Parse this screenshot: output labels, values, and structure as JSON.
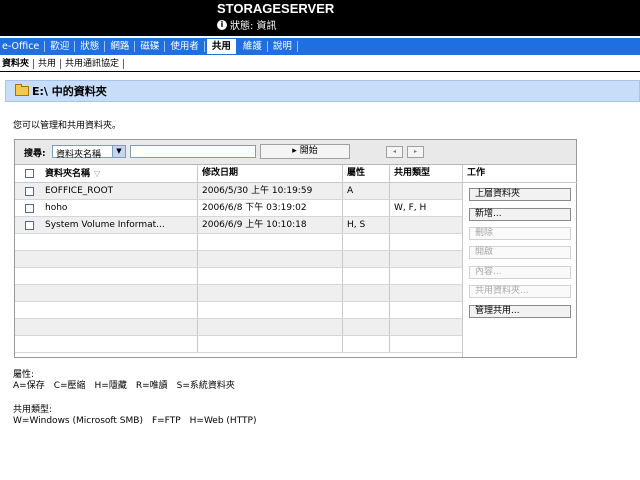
{
  "header": {
    "server_name": "STORAGESERVER",
    "status": "狀態: 資訊"
  },
  "nav": {
    "items": [
      "e-Office",
      "歡迎",
      "狀態",
      "網路",
      "磁碟",
      "使用者",
      "共用",
      "維護",
      "說明"
    ],
    "active": "共用"
  },
  "subnav": {
    "items": [
      "資料夾",
      "共用",
      "共用通訊協定"
    ],
    "active": "資料夾"
  },
  "page": {
    "title": "E:\\ 中的資料夾",
    "description": "您可以管理和共用資料夾。"
  },
  "search": {
    "label": "搜尋:",
    "field_selected": "資料夾名稱",
    "query_value": "",
    "go_label": "開始"
  },
  "table": {
    "columns": [
      "資料夾名稱",
      "修改日期",
      "屬性",
      "共用類型"
    ],
    "rows": [
      [
        "EOFFICE_ROOT",
        "2006/5/30 上午 10:19:59",
        "A",
        ""
      ],
      [
        "hoho",
        "2006/6/8 下午 03:19:02",
        "",
        "W, F, H"
      ],
      [
        "System Volume Informat...",
        "2006/6/9 上午 10:10:18",
        "H, S",
        ""
      ]
    ]
  },
  "actions": {
    "header": "工作",
    "up": "上層資料夾",
    "new": "新增...",
    "delete": "刪除",
    "open": "開啟",
    "properties": "內容...",
    "share": "共用資料夾...",
    "manage": "管理共用..."
  },
  "legend": {
    "attr_title": "屬性:",
    "attr_text": "A=保存　C=壓縮　H=隱藏　R=唯讀　S=系統資料夾",
    "share_title": "共用類型:",
    "share_text": "W=Windows (Microsoft SMB)　F=FTP　H=Web (HTTP)"
  },
  "colors": {
    "nav_bg": "#1f6fe0",
    "title_bg": "#c8ddf7",
    "top_bg": "#000000"
  }
}
